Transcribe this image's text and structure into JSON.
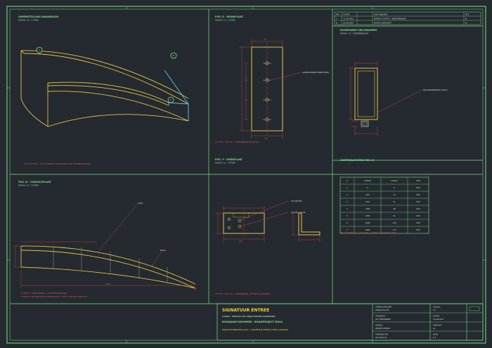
{
  "sheet": {
    "colors": {
      "background": "#252a30",
      "frame": "#7ee08a",
      "part": "#e3c34a",
      "dimension": "#d8464c",
      "cyan": "#59c9e8"
    },
    "views": {
      "assembly": {
        "title": "SAMENSTELLING WAANDELEN",
        "sub": "SCHAAL 1:5 · 1 STUKS",
        "note": "SLUIT OP TEKST - ZIE UITSNEDEN VOOR BENODIGDE VOORBEREIDINGEN",
        "balloons": [
          "A",
          "B",
          "C"
        ]
      },
      "pos_e": {
        "title": "POS. E - WANDPLAAT",
        "sub": "SCHAAL 1:2 · 1 STUKS",
        "callout": "SLOBGATEN/M8 TRADE BORG",
        "dim_top": "60",
        "dim_bottom": "140",
        "note": "4x POS E - RVS 316 - LASERSNIJDEN EN ZETTEN"
      },
      "detail": {
        "title": "DOORSNEDE VRIJ INNAMEN",
        "sub": "SCHAAL 1:2 · DOORSNEDE B-B",
        "callout": "RVS KOKERPROFIEL 40x20",
        "label": "CONTROLEMATEN POS. D"
      },
      "pos_f": {
        "title": "POS. F - HOEKPLAAT",
        "sub": "SCHAAL 1:2 · 4 STUKS",
        "callout1": "GAT Ø9 MM",
        "callout2": "GAT Ø9 / 2x M8",
        "dim": "100",
        "note": "4x POS F - RVS 316 - LASERSNIJDEN, ZETTEN EN AFBRAMEN"
      },
      "pos_d": {
        "title": "POS. D - CONSOLEPLAAT",
        "sub": "SCHAAL 1:5 · 2 STUKS",
        "callout1": "ZAAG",
        "callout2": "NAAD",
        "dim": "2400",
        "note1": "2x POS D - LASERSNIJDEN - LAATSTE BUITENKANT",
        "note2": "CONTROLE BIJ MONTAGE OP WERKPLAATS - VOOR AANVANG FABRICAGE"
      },
      "table": {
        "headers": [
          "A",
          "X-MAAT",
          "Y-MAAT",
          "RAD"
        ],
        "rows": [
          [
            "1",
            "0",
            "0",
            "R50"
          ],
          [
            "2",
            "400",
            "12",
            "R50"
          ],
          [
            "3",
            "800",
            "31",
            "R50"
          ],
          [
            "4",
            "1200",
            "58",
            "R50"
          ],
          [
            "5",
            "1600",
            "91",
            "R50"
          ],
          [
            "6",
            "2000",
            "128",
            "R50"
          ],
          [
            "7",
            "2400",
            "170",
            "R50"
          ]
        ],
        "note": "MAATVOERING T.O.V. NULPUNT - CONTROLE OP WERKPLAATS"
      },
      "revisions": {
        "headers": [
          "REV",
          "DATUM",
          "OMSCHRIJVING",
          "GET."
        ],
        "rows": [
          [
            "A",
            "12-06-2023",
            "EERSTE UITGIFTE - WERKTEKENING",
            "JV"
          ],
          [
            "B",
            "18-06-2023",
            "MATEN AANGEPAST",
            "JV"
          ]
        ]
      },
      "title_block": {
        "title": "SIGNATUUR ENTREE",
        "subtitle": "LASER - DETAILS EN VRIJE BAGEN EXBOEKEN",
        "line2": "BOUWJAAR KROMMEN - BOUWPROJECT BOLD",
        "line3": "PRODUCTIEWERKPLAATS - CONTROLE MATEN VOOR AANVANG",
        "fields": [
          {
            "label": "OPDRACHTGEVER",
            "value": "SIGNATUUR BV"
          },
          {
            "label": "TEKENAAR",
            "value": "JVD TEKENWERK"
          },
          {
            "label": "GEZIEN",
            "value": "PROJECTLEIDER"
          },
          {
            "label": "TEKENING NR.",
            "value": "JVD-2023-01"
          }
        ],
        "meta": [
          {
            "label": "SCHAAL",
            "value": "1:5"
          },
          {
            "label": "DATUM",
            "value": "12-06-2023"
          },
          {
            "label": "FORMAAT",
            "value": "A1"
          },
          {
            "label": "BLAD",
            "value": "1/1"
          }
        ]
      }
    }
  }
}
